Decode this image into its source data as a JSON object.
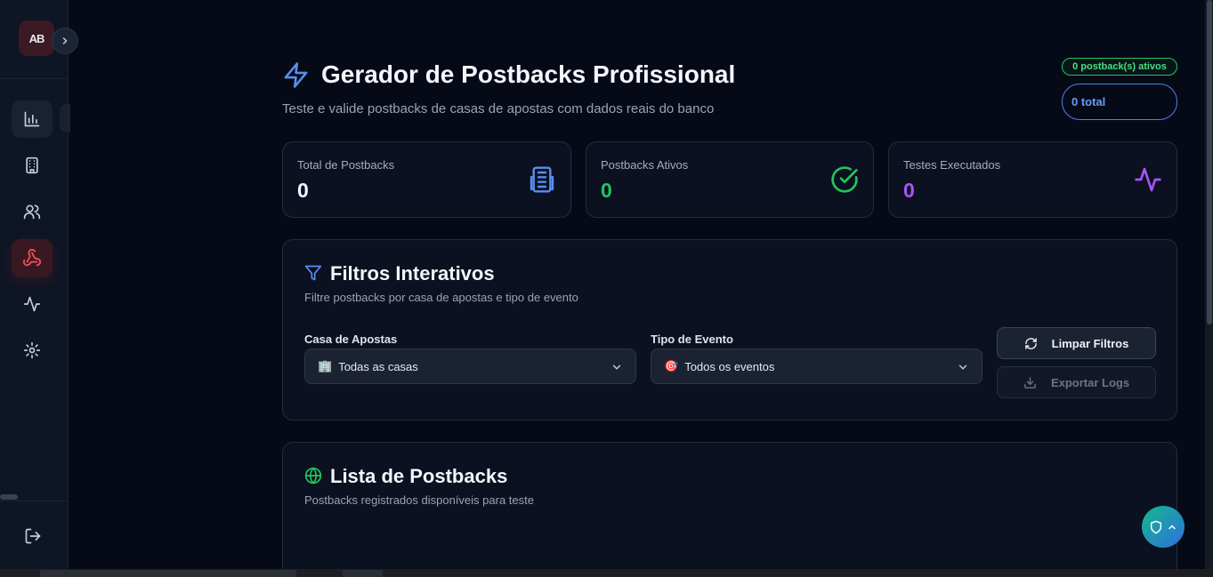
{
  "sidebar": {
    "logo_text": "AB",
    "nav": [
      {
        "icon": "bar-chart-icon"
      },
      {
        "icon": "building-icon"
      },
      {
        "icon": "users-icon"
      },
      {
        "icon": "webhook-icon",
        "active": true
      },
      {
        "icon": "activity-icon"
      },
      {
        "icon": "settings-icon"
      }
    ],
    "logout_icon": "logout-icon"
  },
  "header": {
    "title": "Gerador de Postbacks Profissional",
    "subtitle": "Teste e valide postbacks de casas de apostas com dados reais do banco",
    "active_badge": "0 postback(s) ativos",
    "total_badge": "0 total"
  },
  "stats": [
    {
      "label": "Total de Postbacks",
      "value": "0",
      "color": "#f4f6fb",
      "icon": "building-icon"
    },
    {
      "label": "Postbacks Ativos",
      "value": "0",
      "color": "#22c55e",
      "icon": "check-circle-icon"
    },
    {
      "label": "Testes Executados",
      "value": "0",
      "color": "#a855f7",
      "icon": "activity-icon"
    }
  ],
  "filters": {
    "title": "Filtros Interativos",
    "subtitle": "Filtre postbacks por casa de apostas e tipo de evento",
    "casa_label": "Casa de Apostas",
    "casa_value": "Todas as casas",
    "casa_emoji": "🏢",
    "evento_label": "Tipo de Evento",
    "evento_value": "Todos os eventos",
    "evento_emoji": "🎯",
    "clear_button": "Limpar Filtros",
    "export_button": "Exportar Logs"
  },
  "list": {
    "title": "Lista de Postbacks",
    "subtitle": "Postbacks registrados disponíveis para teste"
  },
  "colors": {
    "accent_blue": "#5b8def",
    "green": "#22c55e",
    "purple": "#a855f7",
    "red": "#ef4444"
  }
}
